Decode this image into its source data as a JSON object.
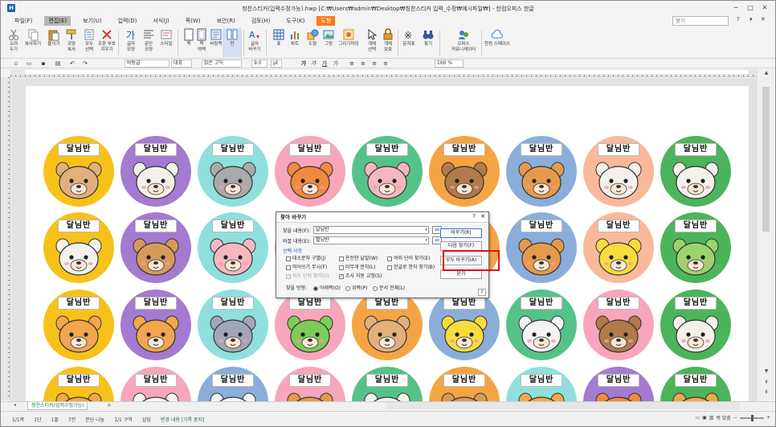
{
  "window": {
    "title": "청찬스티커(입력수정가능).hwp [C:₩Users₩admin₩Desktop₩칭찬스티커 입력_수정₩예시파일₩] - 한컴오피스 한글",
    "app_icon": "H",
    "controls": [
      "─",
      "□",
      "✕"
    ]
  },
  "menu": {
    "items": [
      {
        "label": "파일(F)",
        "state": "normal"
      },
      {
        "label": "편집(E)",
        "state": "active"
      },
      {
        "label": "보기(U)",
        "state": "normal"
      },
      {
        "label": "입력(D)",
        "state": "normal"
      },
      {
        "label": "서식(J)",
        "state": "normal"
      },
      {
        "label": "쪽(W)",
        "state": "normal"
      },
      {
        "label": "보안(R)",
        "state": "normal"
      },
      {
        "label": "검토(H)",
        "state": "normal"
      },
      {
        "label": "도구(K)",
        "state": "normal"
      },
      {
        "label": "도형",
        "state": "accent"
      }
    ],
    "search_placeholder": "찾기",
    "right_controls": [
      "?",
      "▾",
      "✕"
    ]
  },
  "ribbon": {
    "buttons": [
      {
        "label": "오려\n두기",
        "icon": "scissors-icon"
      },
      {
        "label": "복사하기",
        "icon": "copy-icon"
      },
      {
        "label": "붙이기",
        "icon": "paste-icon"
      },
      {
        "label": "모양\n복사",
        "icon": "format-painter-icon"
      },
      {
        "label": "모두\n선택",
        "icon": "select-all-icon"
      },
      {
        "label": "조판 부호\n지우기",
        "icon": "clear-icon"
      },
      {
        "label": "글자\n모양",
        "icon": "font-icon"
      },
      {
        "label": "문단\n모양",
        "icon": "paragraph-icon"
      },
      {
        "label": "스타일",
        "icon": "style-icon"
      },
      {
        "label": "쪽",
        "icon": "page-icon"
      },
      {
        "label": "쪽\n여백",
        "icon": "margin-icon"
      },
      {
        "label": "바탕쪽",
        "icon": "master-page-icon"
      },
      {
        "label": "단",
        "icon": "column-icon"
      },
      {
        "label": "글자\n바꾸기",
        "icon": "replace-char-icon"
      },
      {
        "label": "표",
        "icon": "table-icon"
      },
      {
        "label": "차트",
        "icon": "chart-icon"
      },
      {
        "label": "도형",
        "icon": "shape-icon"
      },
      {
        "label": "그림",
        "icon": "picture-icon"
      },
      {
        "label": "그리기마당",
        "icon": "clipart-icon"
      },
      {
        "label": "개체\n선택",
        "icon": "object-select-icon"
      },
      {
        "label": "개체\n보호",
        "icon": "lock-icon"
      },
      {
        "label": "문자표",
        "icon": "symbol-icon"
      },
      {
        "label": "찾기",
        "icon": "binoculars-icon"
      },
      {
        "label": "오피스\n커뮤니케이터",
        "icon": "messenger-icon"
      },
      {
        "label": "한컴 스페이스",
        "icon": "cloud-icon"
      }
    ]
  },
  "format_bar": {
    "style": "바탕글",
    "font_lang": "대표",
    "font": "맑은 고딕",
    "size": "9.0",
    "unit": "pt",
    "zoom": "160 %"
  },
  "stickers": {
    "label": "달님반",
    "rows": [
      [
        {
          "bg": "#f6c21a",
          "animal": "dog"
        },
        {
          "bg": "#a37bd0",
          "animal": "cow"
        },
        {
          "bg": "#8fe0dc",
          "animal": "mouse"
        },
        {
          "bg": "#f7a6bb",
          "animal": "fox"
        },
        {
          "bg": "#55c28a",
          "animal": "pig"
        },
        {
          "bg": "#f5a443",
          "animal": "horse"
        },
        {
          "bg": "#8aaed9",
          "animal": "cat"
        },
        {
          "bg": "#f9b99a",
          "animal": "sheep"
        },
        {
          "bg": "#4cb45a",
          "animal": "rabbit"
        }
      ],
      [
        {
          "bg": "#f6c21a",
          "animal": "sheep"
        },
        {
          "bg": "#a37bd0",
          "animal": "bear"
        },
        {
          "bg": "#8fe0dc",
          "animal": "pig"
        },
        {
          "bg": "#f7a6bb",
          "animal": "pig"
        },
        {
          "bg": "#55c28a",
          "animal": "chick"
        },
        {
          "bg": "#f5a443",
          "animal": "chick"
        },
        {
          "bg": "#8aaed9",
          "animal": "cat"
        },
        {
          "bg": "#f9b99a",
          "animal": "chick"
        },
        {
          "bg": "#4cb45a",
          "animal": "turtle"
        }
      ],
      [
        {
          "bg": "#f6c21a",
          "animal": "tiger"
        },
        {
          "bg": "#a37bd0",
          "animal": "tiger"
        },
        {
          "bg": "#8fe0dc",
          "animal": "elephant"
        },
        {
          "bg": "#f7a6bb",
          "animal": "frog"
        },
        {
          "bg": "#f5a443",
          "animal": "dog"
        },
        {
          "bg": "#8aaed9",
          "animal": "chick"
        },
        {
          "bg": "#55c28a",
          "animal": "polar-bear"
        },
        {
          "bg": "#f7a6bb",
          "animal": "horse"
        },
        {
          "bg": "#4cb45a",
          "animal": "cow"
        }
      ],
      [
        {
          "bg": "#f6c21a",
          "animal": "tiger"
        },
        {
          "bg": "#f7a6bb",
          "animal": "zebra"
        },
        {
          "bg": "#8aaed9",
          "animal": "panda"
        },
        {
          "bg": "#f7a6bb",
          "animal": "cat"
        },
        {
          "bg": "#55c28a",
          "animal": "rabbit"
        },
        {
          "bg": "#f5a443",
          "animal": "bear"
        },
        {
          "bg": "#8fe0dc",
          "animal": "tiger"
        },
        {
          "bg": "#a37bd0",
          "animal": "bird"
        },
        {
          "bg": "#4cb45a",
          "animal": "tiger"
        }
      ]
    ]
  },
  "dialog": {
    "title": "찾아 바꾸기",
    "help": "?",
    "close": "✕",
    "find_label": "찾을 내용(F):",
    "find_value": "달님반",
    "replace_label": "바꿀 내용(E):",
    "replace_value": "별님반",
    "options_title": "선택 사항",
    "options": [
      {
        "label": "대소문자 구별(J)",
        "checked": false,
        "disabled": false
      },
      {
        "label": "온전한 낱말(W)",
        "checked": false,
        "disabled": false
      },
      {
        "label": "여러 단어 찾기(E)",
        "checked": false,
        "disabled": false
      },
      {
        "label": "띄어쓰기 무시(F)",
        "checked": false,
        "disabled": false
      },
      {
        "label": "아무개 문자(L)",
        "checked": false,
        "disabled": false
      },
      {
        "label": "한글로 한자 찾기(B)",
        "checked": false,
        "disabled": false
      },
      {
        "label": "자소 단위 찾기(U)",
        "checked": false,
        "disabled": true
      },
      {
        "label": "조사 자동 교정(S)",
        "checked": true,
        "disabled": false
      }
    ],
    "direction_label": "찾을 방향:",
    "directions": [
      {
        "label": "아래쪽(O)",
        "selected": true
      },
      {
        "label": "위쪽(P)",
        "selected": false
      },
      {
        "label": "문서 전체(L)",
        "selected": false
      }
    ],
    "buttons": {
      "replace": "바꾸기(R)",
      "find_next": "다음 찾기(F)",
      "replace_all": "모두 바꾸기(A)",
      "close": "닫기"
    },
    "q_btn": "?"
  },
  "sheet_tab": "청찬스티커(입력수정가능)",
  "status": {
    "items": [
      "1/1쪽",
      "1단",
      "1줄",
      "7칸",
      "문단 나눔",
      "1/1 구역",
      "삽입"
    ],
    "change": "변경 내용 [기록 중지]",
    "zoom_fit": "쪽 맞춤"
  },
  "colors": {
    "highlight": "#e0101a",
    "accent_tab": "#ff7a1a",
    "link_blue": "#1a5fb4"
  }
}
